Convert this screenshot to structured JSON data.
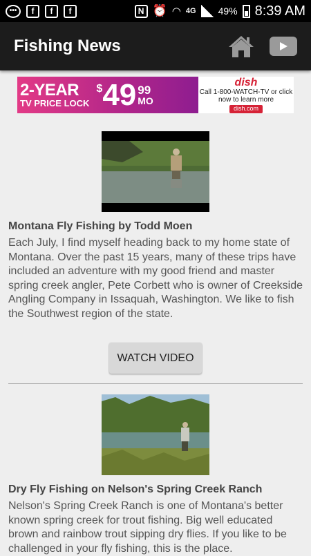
{
  "status_bar": {
    "battery": "49%",
    "time": "8:39 AM",
    "network": "4G",
    "icons": [
      "message-icon",
      "facebook-icon",
      "facebook-icon",
      "facebook-icon",
      "nfc-icon",
      "alarm-icon",
      "wifi-icon",
      "signal-icon",
      "battery-icon"
    ]
  },
  "app_bar": {
    "title": "Fishing News",
    "icons": [
      "home-icon",
      "youtube-icon"
    ]
  },
  "ad": {
    "headline": "2-YEAR",
    "subline": "TV PRICE LOCK",
    "dollar": "$",
    "price": "49",
    "cents": "99",
    "per": "MO",
    "brand": "dish",
    "cta": "Call 1-800-WATCH-TV or click now to learn more",
    "url": "dish.com"
  },
  "articles": [
    {
      "title": "Montana Fly Fishing by Todd Moen",
      "body": "Each July, I find myself heading back to my home state of Montana. Over the past 15 years, many of these trips have included an adventure with my good friend and master spring creek angler, Pete Corbett who is owner of Creekside Angling Company in Issaquah, Washington. We like to fish the Southwest region of the state.",
      "button": "WATCH VIDEO"
    },
    {
      "title": "Dry Fly Fishing on Nelson's Spring Creek Ranch",
      "body": "Nelson's Spring Creek Ranch is one of Montana's better known spring creek for trout fishing. Big well educated brown and rainbow trout sipping dry flies. If you like to be challenged in your fly fishing, this is the place."
    }
  ],
  "colors": {
    "action_bar": "#1c1c1c",
    "background": "#eeeeee",
    "ad_magenta": "#d6287f",
    "dish_red": "#d62236"
  }
}
